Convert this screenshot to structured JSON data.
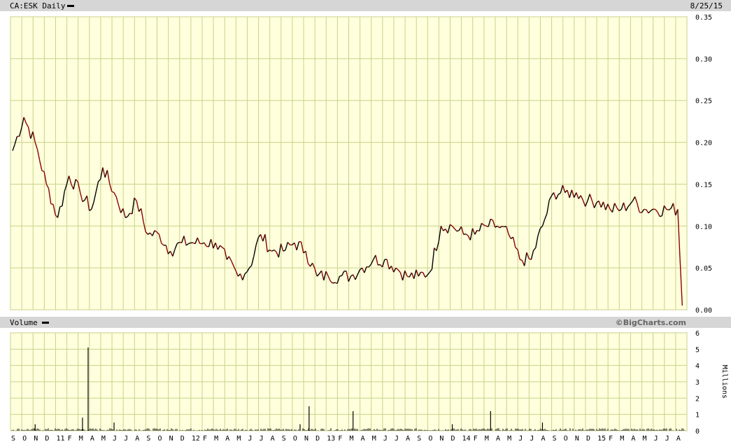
{
  "header": {
    "title": "CA:ESK Daily",
    "date": "8/25/15"
  },
  "volume_header": {
    "title": "Volume",
    "credit": "©BigCharts.com"
  },
  "colors": {
    "plot_bg": "#ffffdd",
    "grid": "#c8d28a",
    "up": "#000000",
    "down": "#8b0000",
    "header_bg": "#d6d6d6"
  },
  "chart_data": [
    {
      "type": "line",
      "title": "CA:ESK Daily",
      "ylim": [
        0,
        0.35
      ],
      "y_ticks": [
        "0.00",
        "0.05",
        "0.10",
        "0.15",
        "0.20",
        "0.25",
        "0.30",
        "0.35"
      ],
      "x_ticks": [
        "S",
        "O",
        "N",
        "D",
        "11",
        "F",
        "M",
        "A",
        "M",
        "J",
        "J",
        "A",
        "S",
        "O",
        "N",
        "D",
        "12",
        "F",
        "M",
        "A",
        "M",
        "J",
        "J",
        "A",
        "S",
        "O",
        "N",
        "D",
        "13",
        "F",
        "M",
        "A",
        "M",
        "J",
        "J",
        "A",
        "S",
        "O",
        "N",
        "D",
        "14",
        "F",
        "M",
        "A",
        "M",
        "J",
        "J",
        "A",
        "S",
        "O",
        "N",
        "D",
        "15",
        "F",
        "M",
        "A",
        "M",
        "J",
        "J",
        "A"
      ],
      "grid": true,
      "series": [
        {
          "x": [
            0,
            1,
            2,
            3,
            4,
            5,
            6,
            7,
            8,
            9,
            10,
            11,
            12,
            13,
            14,
            15,
            16,
            17,
            18,
            19,
            20,
            21,
            22,
            23,
            24,
            25,
            26,
            27,
            28,
            29,
            30,
            31,
            32,
            33,
            34,
            35,
            36,
            37,
            38,
            39,
            40,
            41,
            42,
            43,
            44,
            45,
            46,
            47,
            48,
            49,
            50,
            51,
            52,
            53,
            54,
            55,
            56,
            57,
            58,
            59,
            59.4
          ],
          "values": [
            0.19,
            0.23,
            0.2,
            0.15,
            0.11,
            0.16,
            0.14,
            0.12,
            0.17,
            0.14,
            0.11,
            0.13,
            0.09,
            0.09,
            0.07,
            0.08,
            0.08,
            0.08,
            0.08,
            0.06,
            0.04,
            0.05,
            0.09,
            0.07,
            0.07,
            0.08,
            0.07,
            0.04,
            0.04,
            0.04,
            0.04,
            0.05,
            0.06,
            0.06,
            0.05,
            0.04,
            0.04,
            0.045,
            0.1,
            0.1,
            0.09,
            0.09,
            0.1,
            0.1,
            0.09,
            0.06,
            0.06,
            0.1,
            0.14,
            0.14,
            0.14,
            0.13,
            0.13,
            0.12,
            0.12,
            0.13,
            0.12,
            0.12,
            0.12,
            0.12,
            0.005
          ]
        }
      ]
    },
    {
      "type": "bar",
      "title": "Volume",
      "ylabel": "Millions",
      "ylim": [
        0,
        6
      ],
      "y_ticks": [
        "0",
        "1",
        "2",
        "3",
        "4",
        "5",
        "6"
      ],
      "spikes": [
        {
          "x": 6.7,
          "value": 5.1
        },
        {
          "x": 6.2,
          "value": 0.8
        },
        {
          "x": 26.3,
          "value": 1.5
        },
        {
          "x": 30.2,
          "value": 1.2
        },
        {
          "x": 42.4,
          "value": 1.2
        },
        {
          "x": 9.0,
          "value": 0.5
        },
        {
          "x": 25.5,
          "value": 0.4
        },
        {
          "x": 39.0,
          "value": 0.4
        },
        {
          "x": 47.0,
          "value": 0.5
        },
        {
          "x": 2.0,
          "value": 0.4
        }
      ]
    }
  ]
}
